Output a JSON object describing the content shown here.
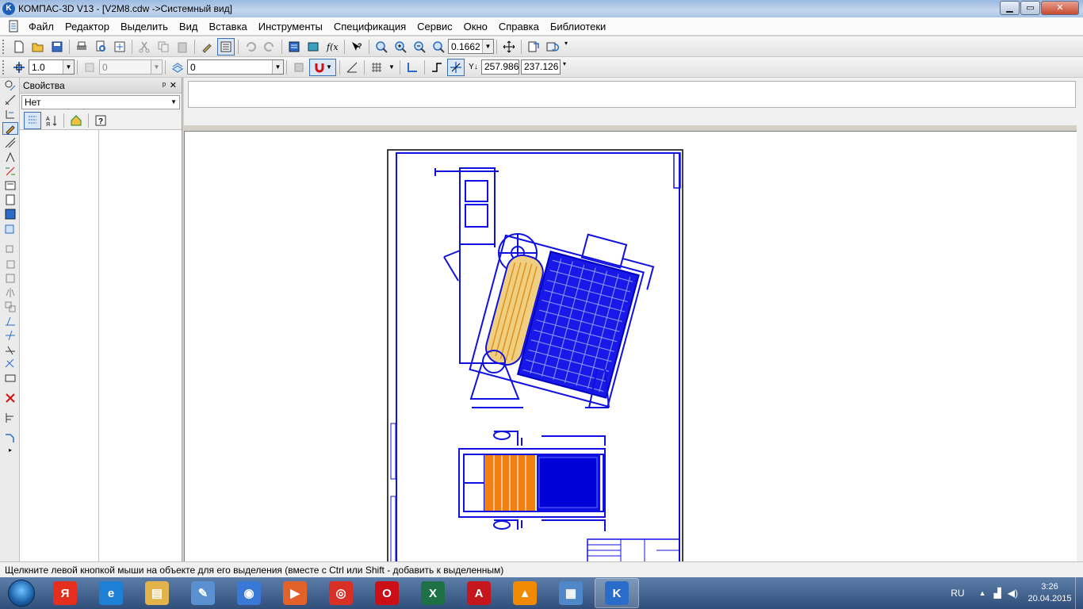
{
  "window": {
    "title": "КОМПАС-3D V13 - [V2M8.cdw ->Системный вид]",
    "app_icon": "kompas-logo-icon",
    "controls": {
      "minimize": "▁",
      "maximize": "▭",
      "close": "✕"
    }
  },
  "menu": [
    "Файл",
    "Редактор",
    "Выделить",
    "Вид",
    "Вставка",
    "Инструменты",
    "Спецификация",
    "Сервис",
    "Окно",
    "Справка",
    "Библиотеки"
  ],
  "doc_controls": {
    "minimize": "‒",
    "restore": "⧉",
    "close": "✕"
  },
  "toolbar1": {
    "zoom_value": "0.1662",
    "icons": [
      "new-document-icon",
      "open-folder-icon",
      "save-icon",
      "print-icon",
      "preview-icon",
      "page-setup-icon",
      "cut-icon",
      "copy-icon",
      "paste-icon",
      "format-brush-icon",
      "properties-icon",
      "undo-icon",
      "redo-icon",
      "manager-icon",
      "library-icon",
      "variables-icon",
      "help-cursor-icon",
      "zoom-window-icon",
      "zoom-in-icon",
      "zoom-out-icon",
      "zoom-scale-icon",
      "pan-icon",
      "refresh-icon",
      "rebuild-icon"
    ]
  },
  "toolbar2": {
    "step_value": "1.0",
    "layer_value": "0",
    "style_value": "0",
    "coord_x": "257.986",
    "coord_y": "237.126",
    "coord_label": "Y↓"
  },
  "props_panel": {
    "title": "Свойства",
    "pin": "ᵖ",
    "close": "✕",
    "combo_value": "Нет"
  },
  "status_text": "Щелкните левой кнопкой мыши на объекте для его выделения (вместе с Ctrl или Shift - добавить к выделенным)",
  "taskbar": {
    "apps": [
      {
        "name": "yandex-browser-icon",
        "glyph": "Я",
        "color": "#e62e1e"
      },
      {
        "name": "internet-explorer-icon",
        "glyph": "e",
        "color": "#1e7fd6"
      },
      {
        "name": "explorer-folder-icon",
        "glyph": "▤",
        "color": "#e2b34a"
      },
      {
        "name": "paint-icon",
        "glyph": "✎",
        "color": "#5a8fd0"
      },
      {
        "name": "audio-player-icon",
        "glyph": "◉",
        "color": "#3a78d8"
      },
      {
        "name": "media-player-icon",
        "glyph": "▶",
        "color": "#e2622a"
      },
      {
        "name": "chrome-icon",
        "glyph": "◎",
        "color": "#d93025"
      },
      {
        "name": "opera-icon",
        "glyph": "O",
        "color": "#cc0f16"
      },
      {
        "name": "excel-icon",
        "glyph": "X",
        "color": "#1e7145"
      },
      {
        "name": "acrobat-icon",
        "glyph": "A",
        "color": "#c4161c"
      },
      {
        "name": "vlc-icon",
        "glyph": "▲",
        "color": "#f08a00"
      },
      {
        "name": "control-panel-icon",
        "glyph": "▦",
        "color": "#4f87c9"
      },
      {
        "name": "kompas-taskbar-icon",
        "glyph": "K",
        "color": "#2a6cc7"
      }
    ],
    "lang": "RU",
    "time": "3:26",
    "date": "20.04.2015"
  }
}
